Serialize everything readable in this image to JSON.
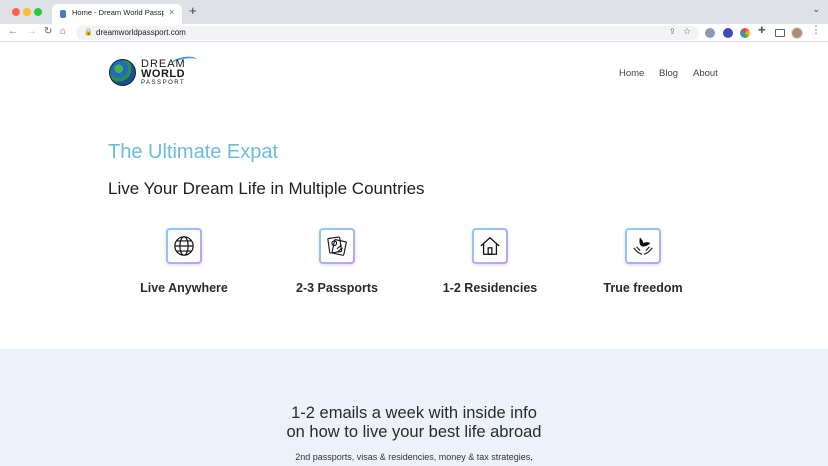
{
  "browser": {
    "tab_title": "Home - Dream World Passport",
    "tab_close": "×",
    "new_tab": "+",
    "tab_menu": "⌄",
    "url": "dreamworldpassport.com",
    "nav": {
      "back": "←",
      "forward": "→",
      "reload": "↻",
      "home": "⌂",
      "lock": "🔒",
      "share": "⇪",
      "star": "☆",
      "puzzle": "✚",
      "menu": "⋮"
    }
  },
  "site": {
    "logo": {
      "line1": "DREAM",
      "line2": "WORLD",
      "line3": "PASSPORT"
    },
    "nav": [
      {
        "label": "Home"
      },
      {
        "label": "Blog"
      },
      {
        "label": "About"
      }
    ]
  },
  "hero": {
    "kicker": "The Ultimate Expat",
    "title": "Live Your Dream Life in Multiple Countries",
    "accent_color": "#6bbce0"
  },
  "features": [
    {
      "icon": "globe-icon",
      "label": "Live Anywhere"
    },
    {
      "icon": "passport-icon",
      "label": "2-3 Passports"
    },
    {
      "icon": "house-icon",
      "label": "1-2 Residencies"
    },
    {
      "icon": "dove-hands-icon",
      "label": "True freedom"
    }
  ],
  "newsletter": {
    "title_line1": "1-2 emails a week with inside info",
    "title_line2": "on how to live your best life abroad",
    "subtitle": "2nd passports, visas & residencies, money & tax strategies,",
    "background": "#edf2fa"
  }
}
